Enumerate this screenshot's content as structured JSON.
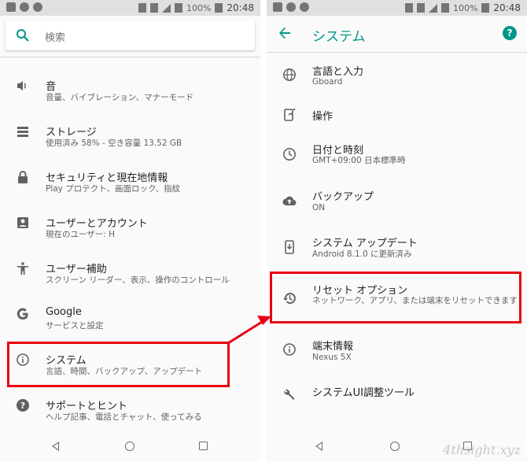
{
  "status_bar": {
    "battery": "100%",
    "time": "20:48"
  },
  "left": {
    "search": {
      "placeholder": "検索"
    },
    "items": [
      {
        "title": "音",
        "subtitle": "音量、バイブレーション、マナーモード",
        "icon": "volume-icon"
      },
      {
        "title": "ストレージ",
        "subtitle": "使用済み 58% - 空き容量 13.52 GB",
        "icon": "storage-icon"
      },
      {
        "title": "セキュリティと現在地情報",
        "subtitle": "Play プロテクト、画面ロック、指紋",
        "icon": "lock-icon"
      },
      {
        "title": "ユーザーとアカウント",
        "subtitle": "現在のユーザー: H",
        "icon": "account-icon"
      },
      {
        "title": "ユーザー補助",
        "subtitle": "スクリーン リーダー、表示、操作のコントロール",
        "icon": "accessibility-icon"
      },
      {
        "title": "Google",
        "subtitle": "サービスと設定",
        "icon": "google-icon"
      },
      {
        "title": "システム",
        "subtitle": "言語、時間、バックアップ、アップデート",
        "icon": "info-icon"
      },
      {
        "title": "サポートとヒント",
        "subtitle": "ヘルプ記事、電話とチャット、使ってみる",
        "icon": "help-icon"
      }
    ]
  },
  "right": {
    "title": "システム",
    "items": [
      {
        "title": "言語と入力",
        "subtitle": "Gboard",
        "icon": "globe-icon"
      },
      {
        "title": "操作",
        "subtitle": "",
        "icon": "gesture-icon"
      },
      {
        "title": "日付と時刻",
        "subtitle": "GMT+09:00 日本標準時",
        "icon": "clock-icon"
      },
      {
        "title": "バックアップ",
        "subtitle": "ON",
        "icon": "cloud-upload-icon"
      },
      {
        "title": "システム アップデート",
        "subtitle": "Android 8.1.0 に更新済み",
        "icon": "system-update-icon"
      },
      {
        "title": "リセット オプション",
        "subtitle": "ネットワーク、アプリ、または端末をリセットできます",
        "icon": "restore-icon"
      },
      {
        "title": "端末情報",
        "subtitle": "Nexus 5X",
        "icon": "info-icon"
      },
      {
        "title": "システムUI調整ツール",
        "subtitle": "",
        "icon": "wrench-icon"
      }
    ]
  },
  "highlight_color": "#e60012",
  "accent_color": "#009688",
  "watermark": "4thsight.xyz"
}
